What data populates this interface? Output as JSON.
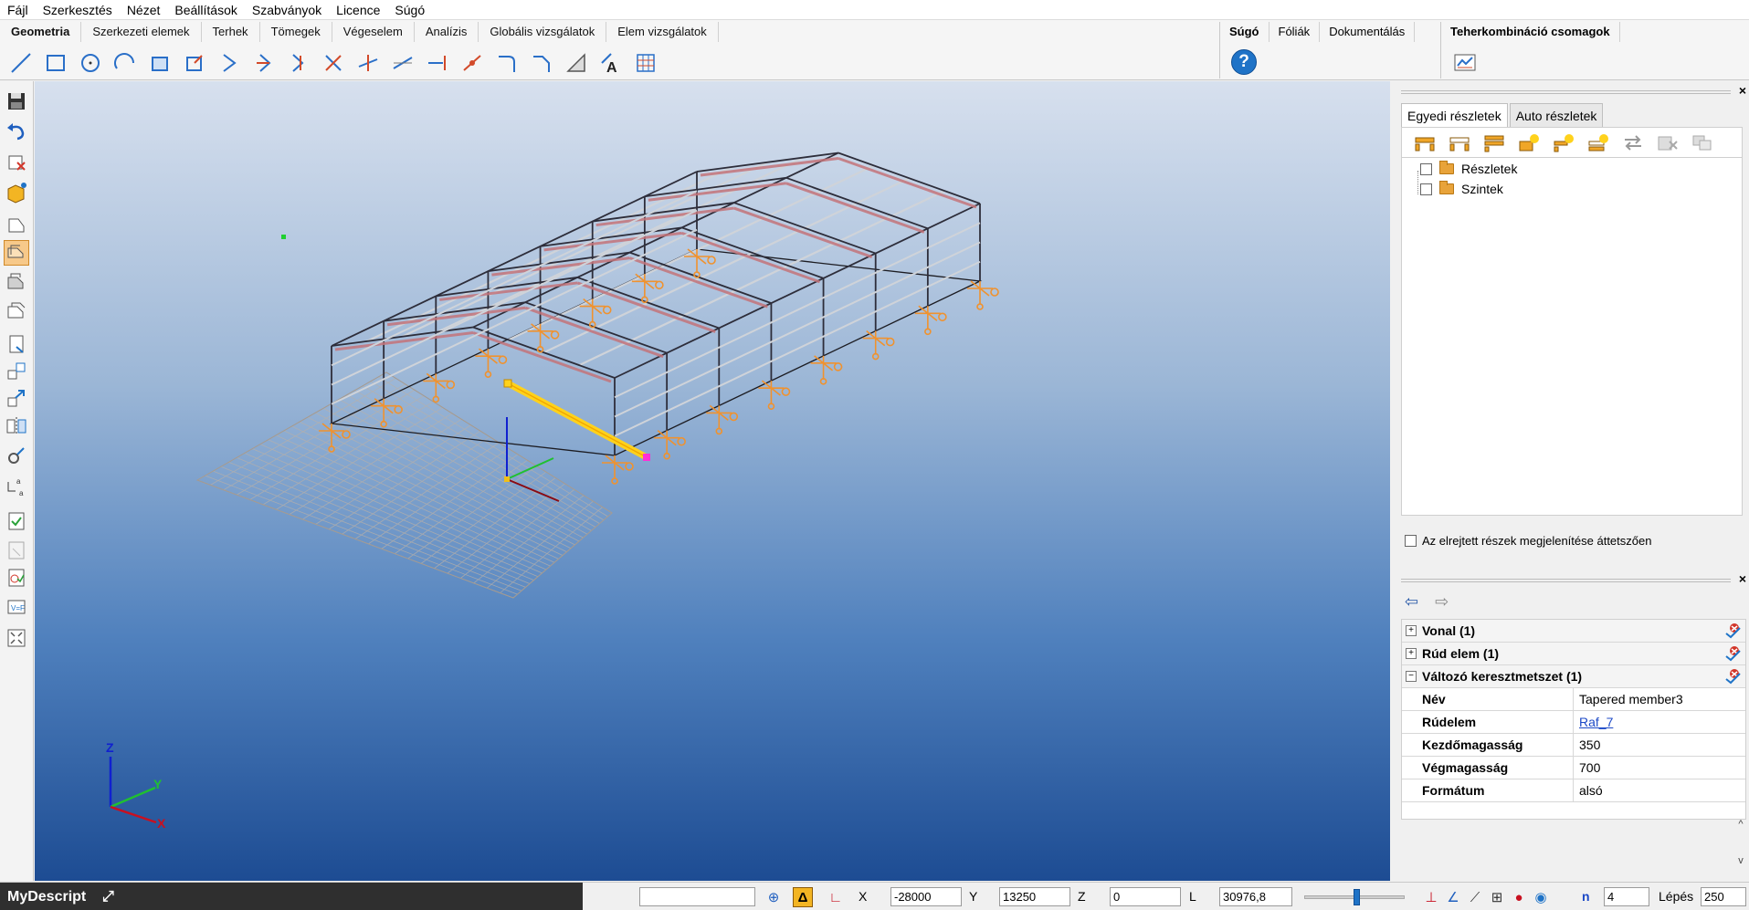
{
  "menu": [
    "Fájl",
    "Szerkesztés",
    "Nézet",
    "Beállítások",
    "Szabványok",
    "Licence",
    "Súgó"
  ],
  "ribbon": {
    "tabs": [
      "Geometria",
      "Szerkezeti elemek",
      "Terhek",
      "Tömegek",
      "Végeselem",
      "Analízis",
      "Globális vizsgálatok",
      "Elem vizsgálatok"
    ],
    "active_tab": "Geometria",
    "help_group": [
      "Súgó",
      "Fóliák",
      "Dokumentálás"
    ],
    "help_icon": "?",
    "combo_group": [
      "Teherkombináció csomagok"
    ]
  },
  "right_panel": {
    "tabs": [
      "Egyedi részletek",
      "Auto részletek"
    ],
    "tree": [
      "Részletek",
      "Szintek"
    ],
    "transparent_checkbox_label": "Az elrejtett részek megjelenítése áttetszően",
    "prop_groups": [
      "Vonal (1)",
      "Rúd elem (1)",
      "Változó keresztmetszet (1)"
    ],
    "props": [
      {
        "key": "Név",
        "value": "Tapered member3"
      },
      {
        "key": "Rúdelem",
        "value": "Raf_7"
      },
      {
        "key": "Kezdőmagasság",
        "value": "350"
      },
      {
        "key": "Végmagasság",
        "value": "700"
      },
      {
        "key": "Formátum",
        "value": "alsó"
      }
    ]
  },
  "axes": {
    "z": "Z",
    "y": "Y",
    "x": "X"
  },
  "status": {
    "mydescript": "MyDescript",
    "x_label": "X",
    "x_value": "-28000",
    "y_label": "Y",
    "y_value": "13250",
    "z_label": "Z",
    "z_value": "0",
    "l_label": "L",
    "l_value": "30976,8",
    "n_label": "n",
    "n_value": "4",
    "step_label": "Lépés",
    "step_value": "250"
  },
  "colors": {
    "frame": "#2d2d3a",
    "purlin": "#c7cbd2",
    "bracing": "#c4747a",
    "support": "#f0922e",
    "selected": "#ffd21c",
    "grid": "#b8b0a8"
  }
}
